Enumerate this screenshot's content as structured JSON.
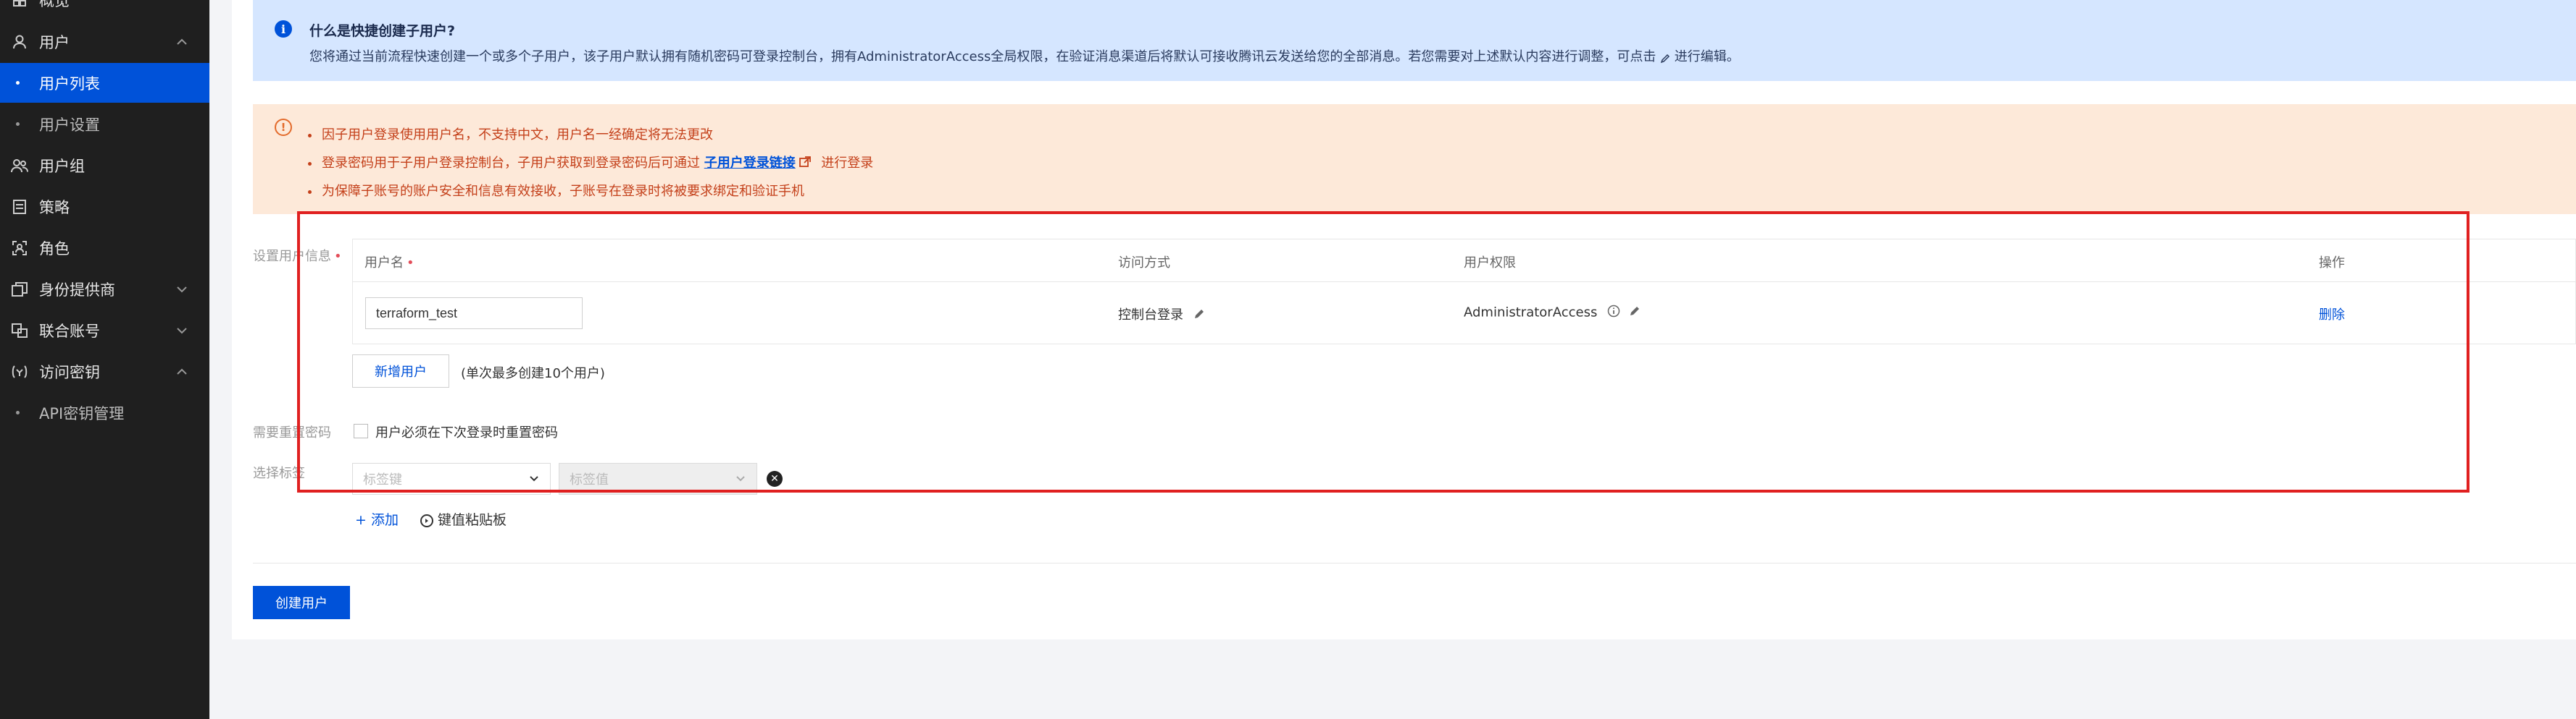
{
  "sidebar": {
    "items": [
      {
        "label": "概览",
        "icon": "overview-icon",
        "type": "top"
      },
      {
        "label": "用户",
        "icon": "user-icon",
        "type": "group",
        "expanded": true
      },
      {
        "label": "用户列表",
        "type": "sub",
        "active": true
      },
      {
        "label": "用户设置",
        "type": "sub"
      },
      {
        "label": "用户组",
        "icon": "user-group-icon",
        "type": "top"
      },
      {
        "label": "策略",
        "icon": "policy-icon",
        "type": "top"
      },
      {
        "label": "角色",
        "icon": "role-icon",
        "type": "top"
      },
      {
        "label": "身份提供商",
        "icon": "identity-provider-icon",
        "type": "group",
        "expanded": false
      },
      {
        "label": "联合账号",
        "icon": "federated-account-icon",
        "type": "group",
        "expanded": false
      },
      {
        "label": "访问密钥",
        "icon": "access-key-icon",
        "type": "group",
        "expanded": true
      },
      {
        "label": "API密钥管理",
        "type": "sub"
      }
    ]
  },
  "info": {
    "title": "什么是快捷创建子用户?",
    "desc_before": "您将通过当前流程快速创建一个或多个子用户，该子用户默认拥有随机密码可登录控制台，拥有AdministratorAccess全局权限，在验证消息渠道后将默认可接收腾讯云发送给您的全部消息。若您需要对上述默认内容进行调整，可点击",
    "desc_after": "进行编辑。"
  },
  "warnings": {
    "line1": "因子用户登录使用用户名，不支持中文，用户名一经确定将无法更改",
    "line2_before": "登录密码用于子用户登录控制台，子用户获取到登录密码后可通过",
    "line2_link": "子用户登录链接",
    "line2_after": "进行登录",
    "line3": "为保障子账号的账户安全和信息有效接收，子账号在登录时将被要求绑定和验证手机"
  },
  "form": {
    "user_info_label": "设置用户信息",
    "columns": {
      "username": "用户名",
      "access": "访问方式",
      "permission": "用户权限",
      "action": "操作"
    },
    "row": {
      "username": "terraform_test",
      "access": "控制台登录",
      "permission": "AdministratorAccess",
      "action": "删除"
    },
    "add_user_button": "新增用户",
    "add_user_hint": "(单次最多创建10个用户)",
    "reset_password_label": "需要重置密码",
    "reset_password_checkbox": "用户必须在下次登录时重置密码",
    "reset_password_checked": false,
    "tags_label": "选择标签",
    "tag_key_placeholder": "标签键",
    "tag_value_placeholder": "标签值",
    "add_tag": "添加",
    "paste_tags": "键值粘贴板"
  },
  "submit_button": "创建用户",
  "colors": {
    "primary": "#0052d9",
    "highlight": "#e02020",
    "warning_text": "#c4401a"
  }
}
